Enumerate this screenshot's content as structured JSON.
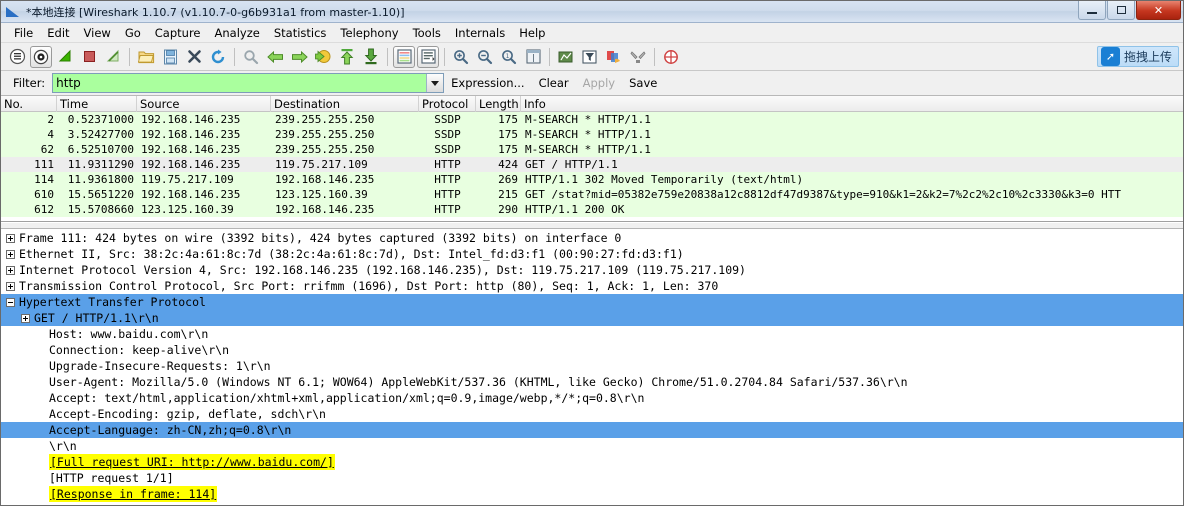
{
  "window": {
    "title": "*本地连接   [Wireshark 1.10.7  (v1.10.7-0-g6b931a1 from master-1.10)]",
    "minimize_label": "Minimize",
    "maximize_label": "Maximize",
    "close_label": "✕"
  },
  "menubar": {
    "items": [
      {
        "label": "File"
      },
      {
        "label": "Edit"
      },
      {
        "label": "View"
      },
      {
        "label": "Go"
      },
      {
        "label": "Capture"
      },
      {
        "label": "Analyze"
      },
      {
        "label": "Statistics"
      },
      {
        "label": "Telephony"
      },
      {
        "label": "Tools"
      },
      {
        "label": "Internals"
      },
      {
        "label": "Help"
      }
    ]
  },
  "toolbar": {
    "buttons": [
      {
        "name": "interfaces-icon",
        "glyph": "list"
      },
      {
        "name": "capture-options-icon",
        "glyph": "gear"
      },
      {
        "name": "start-capture-icon",
        "glyph": "start"
      },
      {
        "name": "stop-capture-icon",
        "glyph": "stop"
      },
      {
        "name": "restart-capture-icon",
        "glyph": "restart"
      },
      {
        "name": "open-file-icon",
        "glyph": "folder"
      },
      {
        "name": "save-file-icon",
        "glyph": "save"
      },
      {
        "name": "close-file-icon",
        "glyph": "close"
      },
      {
        "name": "reload-icon",
        "glyph": "reload"
      },
      {
        "name": "find-packet-icon",
        "glyph": "find"
      },
      {
        "name": "go-back-icon",
        "glyph": "back"
      },
      {
        "name": "go-forward-icon",
        "glyph": "forward"
      },
      {
        "name": "go-to-packet-icon",
        "glyph": "goto"
      },
      {
        "name": "go-first-packet-icon",
        "glyph": "first"
      },
      {
        "name": "go-last-packet-icon",
        "glyph": "last"
      },
      {
        "name": "colorize-icon",
        "glyph": "colorize"
      },
      {
        "name": "auto-scroll-icon",
        "glyph": "autoscroll"
      },
      {
        "name": "zoom-in-icon",
        "glyph": "zoomin"
      },
      {
        "name": "zoom-out-icon",
        "glyph": "zoomout"
      },
      {
        "name": "zoom-normal-icon",
        "glyph": "zoom100"
      },
      {
        "name": "resize-columns-icon",
        "glyph": "resize"
      },
      {
        "name": "capture-filters-icon",
        "glyph": "capfilter"
      },
      {
        "name": "display-filters-icon",
        "glyph": "dispfilter"
      },
      {
        "name": "coloring-rules-icon",
        "glyph": "colorrules"
      },
      {
        "name": "preferences-icon",
        "glyph": "prefs"
      },
      {
        "name": "help-contents-icon",
        "glyph": "help"
      }
    ],
    "upload": {
      "label": "拖拽上传",
      "icon": "upload-icon"
    }
  },
  "filterbar": {
    "label": "Filter:",
    "value": "http",
    "placeholder": "",
    "expression_label": "Expression...",
    "clear_label": "Clear",
    "apply_label": "Apply",
    "save_label": "Save"
  },
  "packet_list": {
    "columns": [
      "No.",
      "Time",
      "Source",
      "Destination",
      "Protocol",
      "Length",
      "Info"
    ],
    "rows": [
      {
        "no": "2",
        "time": "0.52371000",
        "source": "192.168.146.235",
        "destination": "239.255.255.250",
        "protocol": "SSDP",
        "length": "175",
        "info": "M-SEARCH * HTTP/1.1",
        "state": "normal"
      },
      {
        "no": "4",
        "time": "3.52427700",
        "source": "192.168.146.235",
        "destination": "239.255.255.250",
        "protocol": "SSDP",
        "length": "175",
        "info": "M-SEARCH * HTTP/1.1",
        "state": "normal"
      },
      {
        "no": "62",
        "time": "6.52510700",
        "source": "192.168.146.235",
        "destination": "239.255.255.250",
        "protocol": "SSDP",
        "length": "175",
        "info": "M-SEARCH * HTTP/1.1",
        "state": "normal"
      },
      {
        "no": "111",
        "time": "11.9311290",
        "source": "192.168.146.235",
        "destination": "119.75.217.109",
        "protocol": "HTTP",
        "length": "424",
        "info": "GET / HTTP/1.1",
        "state": "selected"
      },
      {
        "no": "114",
        "time": "11.9361800",
        "source": "119.75.217.109",
        "destination": "192.168.146.235",
        "protocol": "HTTP",
        "length": "269",
        "info": "HTTP/1.1 302 Moved Temporarily  (text/html)",
        "state": "normal"
      },
      {
        "no": "610",
        "time": "15.5651220",
        "source": "192.168.146.235",
        "destination": "123.125.160.39",
        "protocol": "HTTP",
        "length": "215",
        "info": "GET /stat?mid=05382e759e20838a12c8812df47d9387&type=910&k1=2&k2=7%2c2%2c10%2c3330&k3=0 HTT",
        "state": "normal"
      },
      {
        "no": "612",
        "time": "15.5708660",
        "source": "123.125.160.39",
        "destination": "192.168.146.235",
        "protocol": "HTTP",
        "length": "290",
        "info": "HTTP/1.1 200 OK",
        "state": "normal"
      }
    ]
  },
  "packet_detail": {
    "rows": [
      {
        "text": "Frame 111: 424 bytes on wire (3392 bits), 424 bytes captured (3392 bits) on interface 0",
        "indent": 0,
        "twisty": "plus",
        "style": "normal"
      },
      {
        "text": "Ethernet II, Src: 38:2c:4a:61:8c:7d (38:2c:4a:61:8c:7d), Dst: Intel_fd:d3:f1 (00:90:27:fd:d3:f1)",
        "indent": 0,
        "twisty": "plus",
        "style": "normal"
      },
      {
        "text": "Internet Protocol Version 4, Src: 192.168.146.235 (192.168.146.235), Dst: 119.75.217.109 (119.75.217.109)",
        "indent": 0,
        "twisty": "plus",
        "style": "normal"
      },
      {
        "text": "Transmission Control Protocol, Src Port: rrifmm (1696), Dst Port: http (80), Seq: 1, Ack: 1, Len: 370",
        "indent": 0,
        "twisty": "plus",
        "style": "normal"
      },
      {
        "text": "Hypertext Transfer Protocol",
        "indent": 0,
        "twisty": "minus",
        "style": "selected"
      },
      {
        "text": "GET / HTTP/1.1\\r\\n",
        "indent": 1,
        "twisty": "plus",
        "style": "selected"
      },
      {
        "text": "Host: www.baidu.com\\r\\n",
        "indent": 2,
        "twisty": "none",
        "style": "normal"
      },
      {
        "text": "Connection: keep-alive\\r\\n",
        "indent": 2,
        "twisty": "none",
        "style": "normal"
      },
      {
        "text": "Upgrade-Insecure-Requests: 1\\r\\n",
        "indent": 2,
        "twisty": "none",
        "style": "normal"
      },
      {
        "text": "User-Agent: Mozilla/5.0 (Windows NT 6.1; WOW64) AppleWebKit/537.36 (KHTML, like Gecko) Chrome/51.0.2704.84 Safari/537.36\\r\\n",
        "indent": 2,
        "twisty": "none",
        "style": "normal"
      },
      {
        "text": "Accept: text/html,application/xhtml+xml,application/xml;q=0.9,image/webp,*/*;q=0.8\\r\\n",
        "indent": 2,
        "twisty": "none",
        "style": "normal"
      },
      {
        "text": "Accept-Encoding: gzip, deflate, sdch\\r\\n",
        "indent": 2,
        "twisty": "none",
        "style": "normal"
      },
      {
        "text": "Accept-Language: zh-CN,zh;q=0.8\\r\\n",
        "indent": 2,
        "twisty": "none",
        "style": "selected"
      },
      {
        "text": "\\r\\n",
        "indent": 2,
        "twisty": "none",
        "style": "normal"
      },
      {
        "text": "[Full request URI: http://www.baidu.com/]",
        "indent": 2,
        "twisty": "none",
        "style": "highlight"
      },
      {
        "text": "[HTTP request 1/1]",
        "indent": 2,
        "twisty": "none",
        "style": "normal"
      },
      {
        "text": "[Response in frame: 114]",
        "indent": 2,
        "twisty": "none",
        "style": "highlight"
      }
    ]
  }
}
